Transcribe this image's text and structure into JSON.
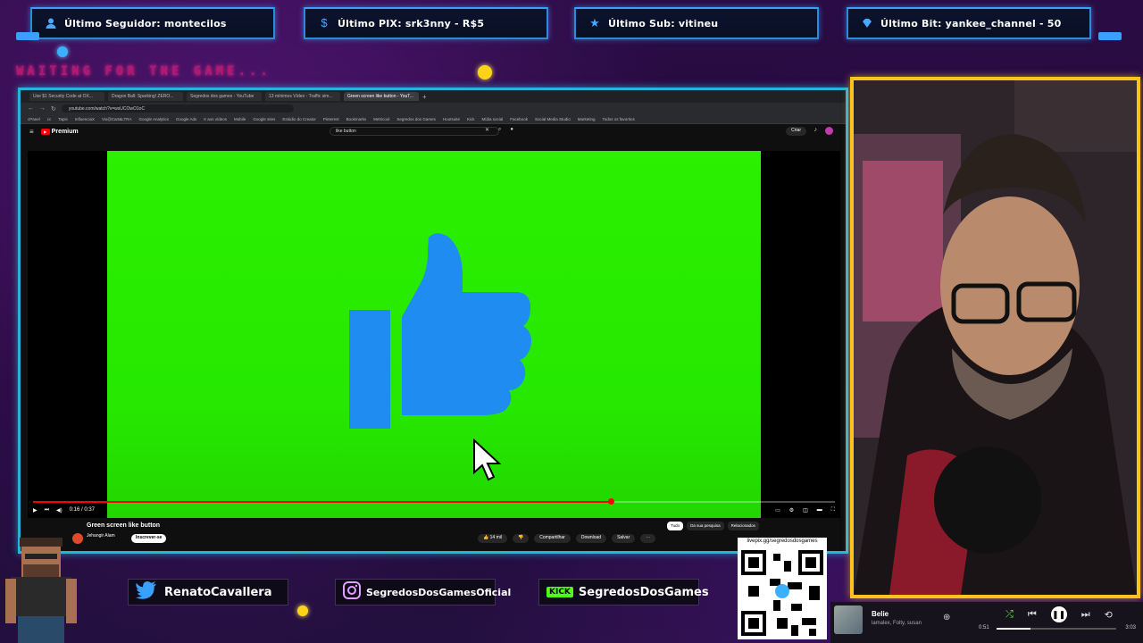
{
  "alerts": [
    {
      "label": "Último Seguidor: montecilos",
      "icon": "user-icon"
    },
    {
      "label": "Último PIX: srk3nny - R$5",
      "icon": "dollar-icon"
    },
    {
      "label": "Último Sub: vitineu",
      "icon": "star-icon"
    },
    {
      "label": "Último Bit: yankee_channel - 50",
      "icon": "diamond-icon"
    }
  ],
  "overlay": {
    "waiting_text": "WAITING FOR THE GAME...",
    "accent_color": "#28b3d8",
    "webcam_border_color": "#ffc21a"
  },
  "browser": {
    "tabs": [
      "Use $1 Security Code at OX...",
      "Dragon Ball: Sparking! ZERO...",
      "Segredos dos games - YouTube",
      "13 mínimos Vídeo - Traffic sim...",
      "Green screen like button - YouT..."
    ],
    "url": "youtube.com/watch?v=wsUCOwO1oC",
    "bookmarks": [
      "cPanel",
      "cc",
      "Tapis",
      "InfluenciaX",
      "Vis@Cart&LTRA",
      "Google Analytics",
      "Google Ads",
      "Ir aos vídeos",
      "Mobile",
      "Google sites",
      "Estúdio do Creator",
      "Pinterest",
      "Bookmarks",
      "Metricool",
      "Segredos dos Games",
      "Hootsuite",
      "Kick",
      "Mídia social",
      "Facebook",
      "Social Media Studio",
      "Marketing",
      "Todos os favoritos"
    ]
  },
  "youtube": {
    "logo": "Premium",
    "search_query": "like button",
    "create_label": "Criar",
    "video_title": "Green screen like button",
    "channel_name": "Jehangir Alam",
    "subscribe_label": "Inscrever-se",
    "likes": "14 mil",
    "actions": [
      "Compartilhar",
      "Download",
      "Salvar"
    ],
    "chips": [
      "Tudo",
      "Da sua pesquisa",
      "Relacionados"
    ],
    "time_display": "0:16 / 0:37",
    "progress_fraction": 0.72
  },
  "socials": {
    "twitter": "RenatoCavallera",
    "instagram": "SegredosDosGamesOficial",
    "kick_badge": "KICK",
    "kick": "SegredosDosGames"
  },
  "qr": {
    "url": "livepix.gg/segredosdosgames"
  },
  "music": {
    "song": "Belie",
    "artist": "lamalex, Folty, susan",
    "time_elapsed": "0:51",
    "time_total": "3:03",
    "progress_fraction": 0.28
  }
}
